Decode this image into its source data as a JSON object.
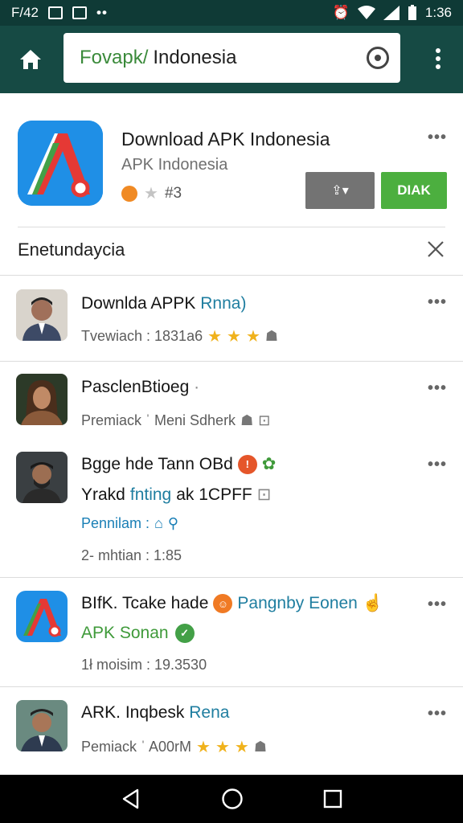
{
  "status_bar": {
    "carrier": "F/42",
    "dots": "••",
    "time": "1:36"
  },
  "search": {
    "prefix": "Fovapk/",
    "query": "Indonesia"
  },
  "app": {
    "title": "Download APK Indonesia",
    "subtitle": "APK Indonesia",
    "rating_text": "#3",
    "share_label": "⇪▾",
    "install_label": "DIAK"
  },
  "section": {
    "title": "Enetundaycia"
  },
  "items": [
    {
      "title": "Downlda APPK",
      "tag": "Rnna)",
      "meta": "Tvewiach : 1831a6"
    },
    {
      "title": "PasclenBtioeg",
      "tag": "·",
      "meta": "Premiack ˈ Meni Sdherk"
    },
    {
      "title": "Bgge hde Tann OBd",
      "line2_prefix": "Yrakd",
      "line2_accent": "fnting",
      "line2_suffix": "ak 1CPFF",
      "line3": "Pennilam :",
      "line4": "2- mhtian : 1:85"
    },
    {
      "title": "BIfK. Tcake hade",
      "tag": "Pangnby Eonen",
      "sub": "APK Sonan",
      "meta": "1ł moisim : 19.3530"
    },
    {
      "title": "ARK. Inqbesk",
      "tag": "Rena",
      "meta": "Pemiack ˈ A00rM"
    }
  ],
  "colors": {
    "status_bar": "#0f3a36",
    "top_bar": "#164a44",
    "install": "#4caf3f",
    "share": "#737373",
    "accent_link": "#1f7ea0"
  }
}
